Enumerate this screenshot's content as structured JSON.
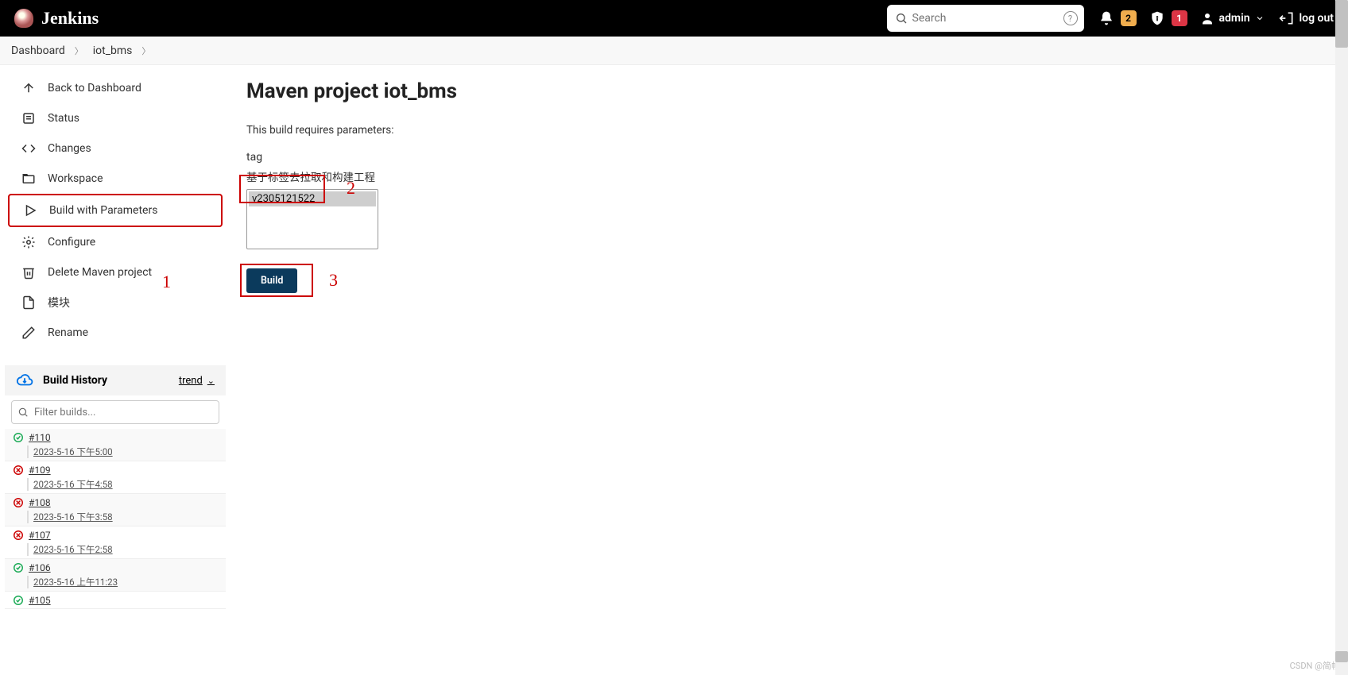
{
  "header": {
    "brand": "Jenkins",
    "search_placeholder": "Search",
    "notif_count": "2",
    "alert_count": "1",
    "user": "admin",
    "logout": "log out"
  },
  "breadcrumb": [
    "Dashboard",
    "iot_bms"
  ],
  "sidebar": {
    "items": [
      {
        "icon": "arrow-up",
        "label": "Back to Dashboard"
      },
      {
        "icon": "status",
        "label": "Status"
      },
      {
        "icon": "code",
        "label": "Changes"
      },
      {
        "icon": "folder",
        "label": "Workspace"
      },
      {
        "icon": "play",
        "label": "Build with Parameters",
        "boxed": true
      },
      {
        "icon": "gear",
        "label": "Configure"
      },
      {
        "icon": "trash",
        "label": "Delete Maven project"
      },
      {
        "icon": "doc",
        "label": "模块"
      },
      {
        "icon": "pencil",
        "label": "Rename"
      }
    ]
  },
  "history": {
    "title": "Build History",
    "trend": "trend",
    "filter_placeholder": "Filter builds...",
    "builds": [
      {
        "status": "ok",
        "num": "#110",
        "time": "2023-5-16 下午5:00"
      },
      {
        "status": "fail",
        "num": "#109",
        "time": "2023-5-16 下午4:58"
      },
      {
        "status": "fail",
        "num": "#108",
        "time": "2023-5-16 下午3:58"
      },
      {
        "status": "fail",
        "num": "#107",
        "time": "2023-5-16 下午2:58"
      },
      {
        "status": "ok",
        "num": "#106",
        "time": "2023-5-16 上午11:23"
      },
      {
        "status": "ok",
        "num": "#105",
        "time": ""
      }
    ]
  },
  "main": {
    "title": "Maven project iot_bms",
    "hint": "This build requires parameters:",
    "param_label": "tag",
    "param_desc": "基于标签去拉取和构建工程",
    "tag_options": [
      "v2305121522"
    ],
    "build_button": "Build"
  },
  "annotations": {
    "a1": "1",
    "a2": "2",
    "a3": "3"
  },
  "watermark": "CSDN @简帧"
}
